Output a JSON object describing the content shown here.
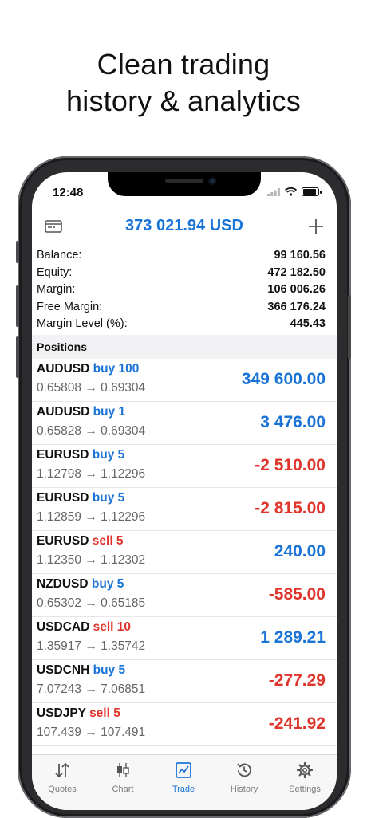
{
  "headline": [
    "Clean trading",
    "history & analytics"
  ],
  "status_bar": {
    "time": "12:48"
  },
  "header": {
    "equity": "373 021.94 USD",
    "wallet_icon": "wallet-icon",
    "add_icon": "plus-icon"
  },
  "summary": [
    {
      "label": "Balance:",
      "value": "99 160.56"
    },
    {
      "label": "Equity:",
      "value": "472 182.50"
    },
    {
      "label": "Margin:",
      "value": "106 006.26"
    },
    {
      "label": "Free Margin:",
      "value": "366 176.24"
    },
    {
      "label": "Margin Level (%):",
      "value": "445.43"
    }
  ],
  "positions_title": "Positions",
  "positions": [
    {
      "symbol": "AUDUSD",
      "type": "buy 100",
      "side": "buy",
      "prices": "0.65808 → 0.69304",
      "profit": "349 600.00",
      "sign": "pos"
    },
    {
      "symbol": "AUDUSD",
      "type": "buy 1",
      "side": "buy",
      "prices": "0.65828 → 0.69304",
      "profit": "3 476.00",
      "sign": "pos"
    },
    {
      "symbol": "EURUSD",
      "type": "buy 5",
      "side": "buy",
      "prices": "1.12798 → 1.12296",
      "profit": "-2 510.00",
      "sign": "neg"
    },
    {
      "symbol": "EURUSD",
      "type": "buy 5",
      "side": "buy",
      "prices": "1.12859 → 1.12296",
      "profit": "-2 815.00",
      "sign": "neg"
    },
    {
      "symbol": "EURUSD",
      "type": "sell 5",
      "side": "sell",
      "prices": "1.12350 → 1.12302",
      "profit": "240.00",
      "sign": "pos"
    },
    {
      "symbol": "NZDUSD",
      "type": "buy 5",
      "side": "buy",
      "prices": "0.65302 → 0.65185",
      "profit": "-585.00",
      "sign": "neg"
    },
    {
      "symbol": "USDCAD",
      "type": "sell 10",
      "side": "sell",
      "prices": "1.35917 → 1.35742",
      "profit": "1 289.21",
      "sign": "pos"
    },
    {
      "symbol": "USDCNH",
      "type": "buy 5",
      "side": "buy",
      "prices": "7.07243 → 7.06851",
      "profit": "-277.29",
      "sign": "neg"
    },
    {
      "symbol": "USDJPY",
      "type": "sell 5",
      "side": "sell",
      "prices": "107.439 → 107.491",
      "profit": "-241.92",
      "sign": "neg"
    }
  ],
  "tabs": [
    {
      "label": "Quotes",
      "icon": "quotes-arrows-icon",
      "active": false
    },
    {
      "label": "Chart",
      "icon": "candlestick-chart-icon",
      "active": false
    },
    {
      "label": "Trade",
      "icon": "trade-chart-icon",
      "active": true
    },
    {
      "label": "History",
      "icon": "history-clock-icon",
      "active": false
    },
    {
      "label": "Settings",
      "icon": "gear-icon",
      "active": false
    }
  ],
  "colors": {
    "accent": "#1a73d6",
    "loss": "#e0352c",
    "muted": "#7a7a7e"
  }
}
